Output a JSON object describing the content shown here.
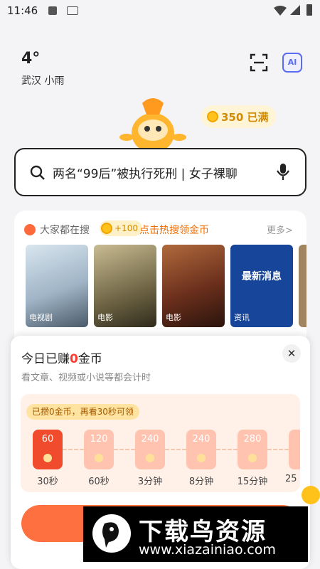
{
  "status_bar": {
    "time": "11:46"
  },
  "weather": {
    "temperature": "4°",
    "location": "武汉 小雨"
  },
  "header": {
    "ai_label": "AI"
  },
  "coins": {
    "label": "350 已满"
  },
  "search": {
    "query": "两名“99后”被执行死刑 | 女子裸聊"
  },
  "hot": {
    "title": "大家都在搜",
    "reward": "+100",
    "promo": "点击热搜领金币",
    "more": "更多>",
    "items": [
      {
        "tag": "电视剧"
      },
      {
        "tag": "电影"
      },
      {
        "tag": "电影"
      },
      {
        "tag": "资讯",
        "headline": "最新消息"
      }
    ]
  },
  "panel": {
    "title_pre": "今日已赚",
    "count": "0",
    "title_post": "金币",
    "subtitle": "看文章、视频或小说等都会计时",
    "hint": "已攒0金币，再看30秒可领",
    "close": "✕",
    "steps": [
      {
        "amount": "60",
        "time": "30秒"
      },
      {
        "amount": "120",
        "time": "60秒"
      },
      {
        "amount": "240",
        "time": "3分钟"
      },
      {
        "amount": "240",
        "time": "8分钟"
      },
      {
        "amount": "280",
        "time": "15分钟"
      },
      {
        "amount": "",
        "time": "25"
      }
    ]
  },
  "watermark": {
    "title": "下载鸟资源",
    "url": "www.xiazainiao.com"
  },
  "colors": {
    "accent": "#ff7040",
    "coin": "#ffc21b",
    "active_envelope": "#ef4b2c"
  }
}
